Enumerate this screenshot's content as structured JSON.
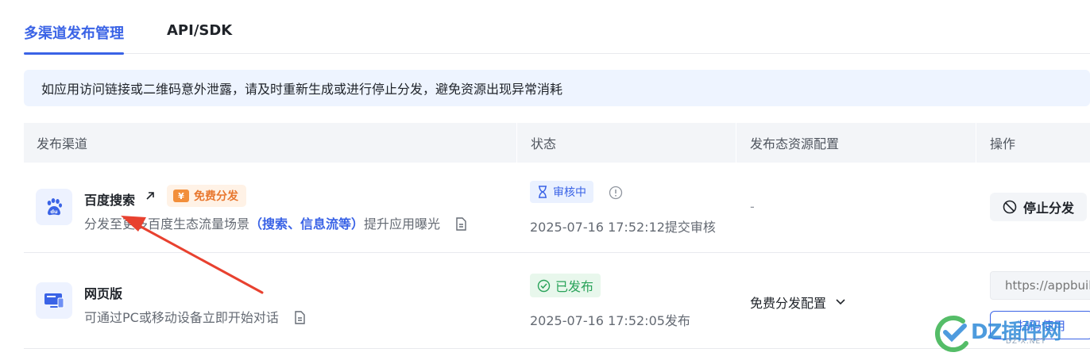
{
  "tabs": [
    {
      "label": "多渠道发布管理",
      "active": true
    },
    {
      "label": "API/SDK",
      "active": false
    }
  ],
  "notice": "如应用访问链接或二维码意外泄露，请及时重新生成或进行停止分发，避免资源出现异常消耗",
  "table": {
    "headers": [
      "发布渠道",
      "状态",
      "发布态资源配置",
      "操作"
    ],
    "rows": [
      {
        "title": "百度搜索",
        "badge": "免费分发",
        "badge_icon": "¥",
        "desc_prefix": "分发至更多百度生态流量场景",
        "desc_highlight": "（搜索、信息流等）",
        "desc_suffix": "提升应用曝光",
        "status": "审核中",
        "status_time": "2025-07-16 17:52:12提交审核",
        "resource": "-",
        "action": "停止分发"
      },
      {
        "title": "网页版",
        "desc": "可通过PC或移动设备立即开始对话",
        "status": "已发布",
        "status_time": "2025-07-16 17:52:05发布",
        "resource": "免费分发配置",
        "url_placeholder": "https://appbuild",
        "action": "扫码使用"
      }
    ]
  },
  "colors": {
    "accent": "#3a63e6",
    "success": "#2aa35a",
    "warning": "#e8772e",
    "annotation": "#e8412f"
  },
  "watermark": {
    "brand": "DZ插件网",
    "sub": "DZ-X.NET"
  }
}
